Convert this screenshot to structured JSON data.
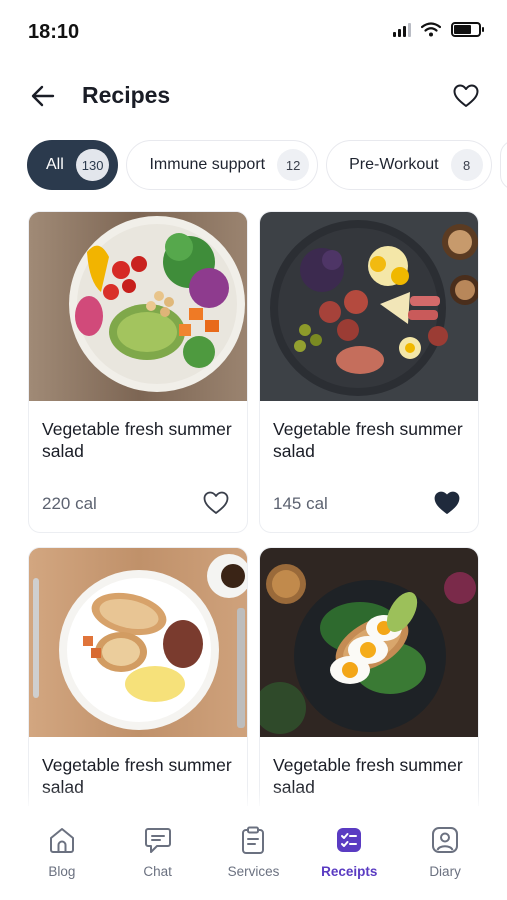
{
  "status_bar": {
    "time": "18:10"
  },
  "header": {
    "title": "Recipes"
  },
  "filters": [
    {
      "label": "All",
      "count": "130",
      "active": true
    },
    {
      "label": "Immune support",
      "count": "12",
      "active": false
    },
    {
      "label": "Pre-Workout",
      "count": "8",
      "active": false
    }
  ],
  "recipes": [
    {
      "title": "Vegetable fresh summer salad",
      "calories": "220 cal",
      "liked": false,
      "image": "salad-bowl"
    },
    {
      "title": "Vegetable fresh summer salad",
      "calories": "145 cal",
      "liked": true,
      "image": "cheese-fruit-platter"
    },
    {
      "title": "Vegetable fresh summer salad",
      "calories": "",
      "liked": false,
      "image": "breakfast-plate"
    },
    {
      "title": "Vegetable fresh summer salad",
      "calories": "",
      "liked": false,
      "image": "egg-toast"
    }
  ],
  "bottom_nav": [
    {
      "label": "Blog",
      "icon": "home-icon",
      "active": false
    },
    {
      "label": "Chat",
      "icon": "chat-icon",
      "active": false
    },
    {
      "label": "Services",
      "icon": "clipboard-icon",
      "active": false
    },
    {
      "label": "Receipts",
      "icon": "checklist-icon",
      "active": true
    },
    {
      "label": "Diary",
      "icon": "user-square-icon",
      "active": false
    }
  ],
  "colors": {
    "accent": "#5a3bc2",
    "chip_active": "#2b3a4d",
    "heart_filled": "#1f2a3c"
  }
}
